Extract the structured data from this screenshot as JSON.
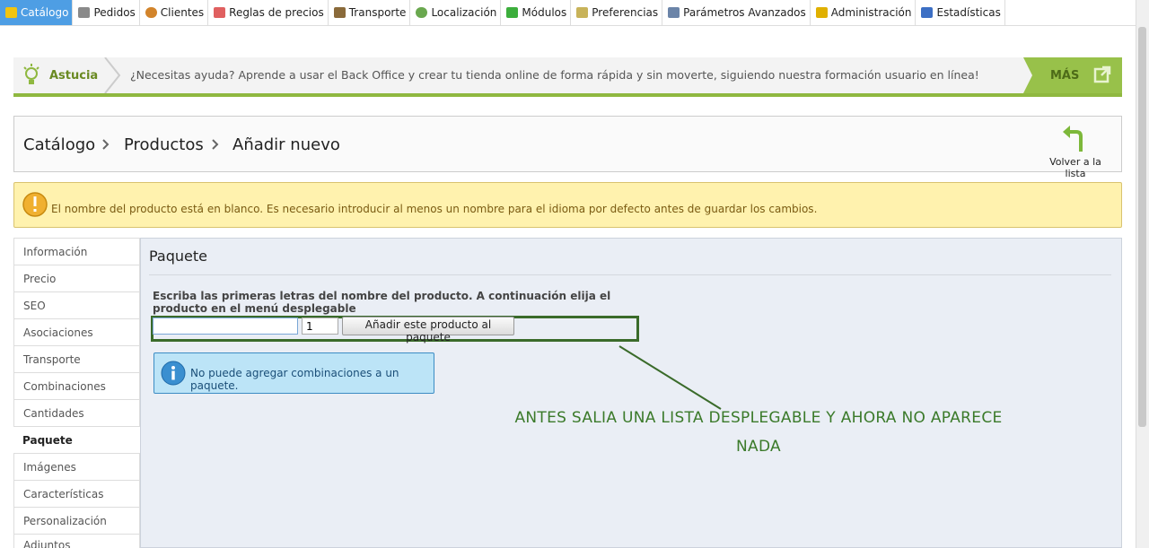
{
  "topnav": {
    "items": [
      {
        "label": "Catálogo",
        "icon": "folder-icon",
        "color": "#f1c40f"
      },
      {
        "label": "Pedidos",
        "icon": "cart-icon",
        "color": "#7a7a7a"
      },
      {
        "label": "Clientes",
        "icon": "user-icon",
        "color": "#d2842b"
      },
      {
        "label": "Reglas de precios",
        "icon": "price-rule-icon",
        "color": "#d55"
      },
      {
        "label": "Transporte",
        "icon": "truck-icon",
        "color": "#8a6a3a"
      },
      {
        "label": "Localización",
        "icon": "globe-icon",
        "color": "#6aa84f"
      },
      {
        "label": "Módulos",
        "icon": "puzzle-icon",
        "color": "#3cae3c"
      },
      {
        "label": "Preferencias",
        "icon": "preferences-icon",
        "color": "#c8b35a"
      },
      {
        "label": "Parámetros Avanzados",
        "icon": "wrench-icon",
        "color": "#6b84a8"
      },
      {
        "label": "Administración",
        "icon": "key-icon",
        "color": "#e0b000"
      },
      {
        "label": "Estadísticas",
        "icon": "bar-chart-icon",
        "color": "#3c6fc4"
      }
    ]
  },
  "tip": {
    "label": "Astucia",
    "text": "¿Necesitas ayuda? Aprende a usar el Back Office y crear tu tienda online de forma rápida y sin moverte, siguiendo nuestra formación usuario en línea!",
    "more_label": "MÁS"
  },
  "breadcrumb": {
    "items": [
      "Catálogo",
      "Productos",
      "Añadir nuevo"
    ],
    "back_label": "Volver a la lista"
  },
  "warning": {
    "text": "El nombre del producto está en blanco. Es necesario introducir al menos un nombre para el idioma por defecto antes de guardar los cambios."
  },
  "sidetabs": {
    "items": [
      "Información",
      "Precio",
      "SEO",
      "Asociaciones",
      "Transporte",
      "Combinaciones",
      "Cantidades",
      "Paquete",
      "Imágenes",
      "Características",
      "Personalización",
      "Adjuntos"
    ]
  },
  "pack": {
    "title": "Paquete",
    "field_label": "Escriba las primeras letras del nombre del producto. A continuación elija el producto en el menú desplegable",
    "product_value": "",
    "qty_value": "1",
    "add_button": "Añadir este producto al paquete",
    "info_text": "No puede agregar combinaciones a un paquete."
  },
  "annotation": {
    "line1": "ANTES SALIA UNA LISTA DESPLEGABLE Y AHORA NO APARECE",
    "line2": "NADA",
    "color": "#3b7a2a"
  }
}
